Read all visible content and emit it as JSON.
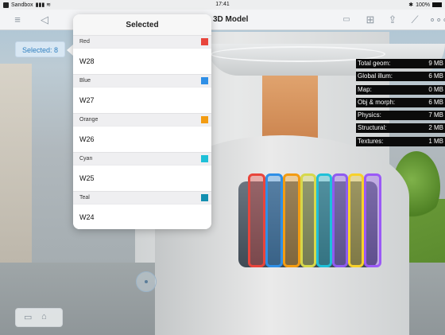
{
  "status_bar": {
    "carrier": "Sandbox",
    "time": "17:41",
    "battery": "100%"
  },
  "toolbar": {
    "title": "3D Model",
    "icons": [
      "menu-icon",
      "back-icon",
      "image-icon",
      "book-icon",
      "share-icon",
      "ruler-icon",
      "more-icon"
    ]
  },
  "selected_badge": {
    "label": "Selected: 8"
  },
  "popover": {
    "title": "Selected",
    "groups": [
      {
        "color_name": "Red",
        "swatch": "#e8453c",
        "item": "W28"
      },
      {
        "color_name": "Blue",
        "swatch": "#2f8fe6",
        "item": "W27"
      },
      {
        "color_name": "Orange",
        "swatch": "#f39c12",
        "item": "W26"
      },
      {
        "color_name": "Cyan",
        "swatch": "#1fc0d8",
        "item": "W25"
      },
      {
        "color_name": "Teal",
        "swatch": "#138fb0",
        "item": "W24"
      }
    ]
  },
  "stats": [
    {
      "label": "Total geom:",
      "value": "9 MB"
    },
    {
      "label": "Global illum:",
      "value": "6 MB"
    },
    {
      "label": "Map:",
      "value": "0 MB"
    },
    {
      "label": "Obj & morph:",
      "value": "6 MB"
    },
    {
      "label": "Physics:",
      "value": "7 MB"
    },
    {
      "label": "Structural:",
      "value": "2 MB"
    },
    {
      "label": "Textures:",
      "value": "1 MB"
    }
  ],
  "highlight_colors": [
    "#e8453c",
    "#2f8fe6",
    "#f39c12",
    "#d6d84b",
    "#1fc0d8",
    "#8e5cf0",
    "#f7d12a",
    "#9b59f6"
  ]
}
